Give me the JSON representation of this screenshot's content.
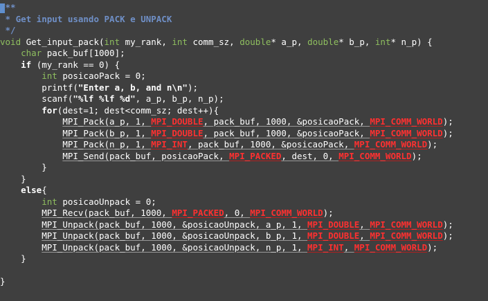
{
  "editor": {
    "lines": [
      [
        [
          "cursor",
          "/"
        ],
        [
          "comment",
          "**"
        ]
      ],
      [
        [
          "comment",
          " * Get input usando PACK e UNPACK"
        ]
      ],
      [
        [
          "comment",
          " */"
        ]
      ],
      [
        [
          "type",
          "void"
        ],
        [
          "plain",
          " Get_input_pack("
        ],
        [
          "type",
          "int"
        ],
        [
          "plain",
          " my_rank, "
        ],
        [
          "type",
          "int"
        ],
        [
          "plain",
          " comm_sz, "
        ],
        [
          "type",
          "double"
        ],
        [
          "plain",
          "* a_p, "
        ],
        [
          "type",
          "double"
        ],
        [
          "plain",
          "* b_p, "
        ],
        [
          "type",
          "int"
        ],
        [
          "plain",
          "* n_p) {"
        ]
      ],
      [
        [
          "plain",
          "    "
        ],
        [
          "type",
          "char"
        ],
        [
          "plain",
          " pack_buf[1000];"
        ]
      ],
      [
        [
          "plain",
          "    "
        ],
        [
          "kw",
          "if"
        ],
        [
          "plain",
          " (my_rank == 0) {"
        ]
      ],
      [
        [
          "plain",
          "        "
        ],
        [
          "type",
          "int"
        ],
        [
          "plain",
          " posicaoPack = 0;"
        ]
      ],
      [
        [
          "plain",
          "        printf("
        ],
        [
          "str",
          "\"Enter a, b, and n\\n\""
        ],
        [
          "plain",
          ");"
        ]
      ],
      [
        [
          "plain",
          "        scanf("
        ],
        [
          "str",
          "\"%lf %lf %d\""
        ],
        [
          "plain",
          ", a_p, b_p, n_p);"
        ]
      ],
      [
        [
          "plain",
          "        "
        ],
        [
          "kw",
          "for"
        ],
        [
          "plain",
          "(dest=1; dest<comm_sz; dest++){"
        ]
      ],
      [
        [
          "plain",
          "            "
        ],
        [
          "uplain",
          "MPI_Pack(a_p, 1, "
        ],
        [
          "umpi",
          "MPI_DOUBLE"
        ],
        [
          "uplain",
          ", pack_buf, 1000, &posicaoPack, "
        ],
        [
          "umpi",
          "MPI_COMM_WORLD"
        ],
        [
          "plain",
          ");"
        ]
      ],
      [
        [
          "plain",
          "            "
        ],
        [
          "uplain",
          "MPI_Pack(b_p, 1, "
        ],
        [
          "umpi",
          "MPI_DOUBLE"
        ],
        [
          "uplain",
          ", pack_buf, 1000, &posicaoPack, "
        ],
        [
          "umpi",
          "MPI_COMM_WORLD"
        ],
        [
          "plain",
          ");"
        ]
      ],
      [
        [
          "plain",
          "            "
        ],
        [
          "uplain",
          "MPI_Pack(n_p, 1, "
        ],
        [
          "umpi",
          "MPI_INT"
        ],
        [
          "uplain",
          ", pack_buf, 1000, &posicaoPack, "
        ],
        [
          "umpi",
          "MPI_COMM_WORLD"
        ],
        [
          "plain",
          ");"
        ]
      ],
      [
        [
          "plain",
          "            "
        ],
        [
          "uplain",
          "MPI_Send(pack_buf, posicaoPack, "
        ],
        [
          "umpi",
          "MPI_PACKED"
        ],
        [
          "uplain",
          ", dest, 0, "
        ],
        [
          "umpi",
          "MPI_COMM_WORLD"
        ],
        [
          "plain",
          ");"
        ]
      ],
      [
        [
          "plain",
          "        }"
        ]
      ],
      [
        [
          "plain",
          "    }"
        ]
      ],
      [
        [
          "plain",
          "    "
        ],
        [
          "kw",
          "else"
        ],
        [
          "plain",
          "{"
        ]
      ],
      [
        [
          "plain",
          "        "
        ],
        [
          "type",
          "int"
        ],
        [
          "plain",
          " posicaoUnpack = 0;"
        ]
      ],
      [
        [
          "plain",
          "        "
        ],
        [
          "uplain",
          "MPI_Recv(pack_buf, 1000, "
        ],
        [
          "umpi",
          "MPI_PACKED"
        ],
        [
          "uplain",
          ", 0, "
        ],
        [
          "umpi",
          "MPI_COMM_WORLD"
        ],
        [
          "plain",
          ");"
        ]
      ],
      [
        [
          "plain",
          "        "
        ],
        [
          "uplain",
          "MPI_Unpack(pack_buf, 1000, &posicaoUnpack, a_p, 1, "
        ],
        [
          "umpi",
          "MPI_DOUBLE"
        ],
        [
          "uplain",
          ", "
        ],
        [
          "umpi",
          "MPI_COMM_WORLD"
        ],
        [
          "plain",
          ");"
        ]
      ],
      [
        [
          "plain",
          "        "
        ],
        [
          "uplain",
          "MPI_Unpack(pack_buf, 1000, &posicaoUnpack, b_p, 1, "
        ],
        [
          "umpi",
          "MPI_DOUBLE"
        ],
        [
          "uplain",
          ", "
        ],
        [
          "umpi",
          "MPI_COMM_WORLD"
        ],
        [
          "plain",
          ");"
        ]
      ],
      [
        [
          "plain",
          "        "
        ],
        [
          "uplain",
          "MPI_Unpack(pack_buf, 1000, &posicaoUnpack, n_p, 1, "
        ],
        [
          "umpi",
          "MPI_INT"
        ],
        [
          "uplain",
          ", "
        ],
        [
          "umpi",
          "MPI_COMM_WORLD"
        ],
        [
          "plain",
          ");"
        ]
      ],
      [
        [
          "plain",
          "    }"
        ]
      ],
      [
        [
          "plain",
          ""
        ]
      ],
      [
        [
          "plain",
          "}"
        ]
      ]
    ]
  },
  "colors": {
    "background": "#3f3f3f",
    "comment": "#6f8fc6",
    "type": "#8fbf5f",
    "mpi_constant": "#ff3030",
    "text": "#ffffff",
    "cursor": "#5e8fcf"
  }
}
